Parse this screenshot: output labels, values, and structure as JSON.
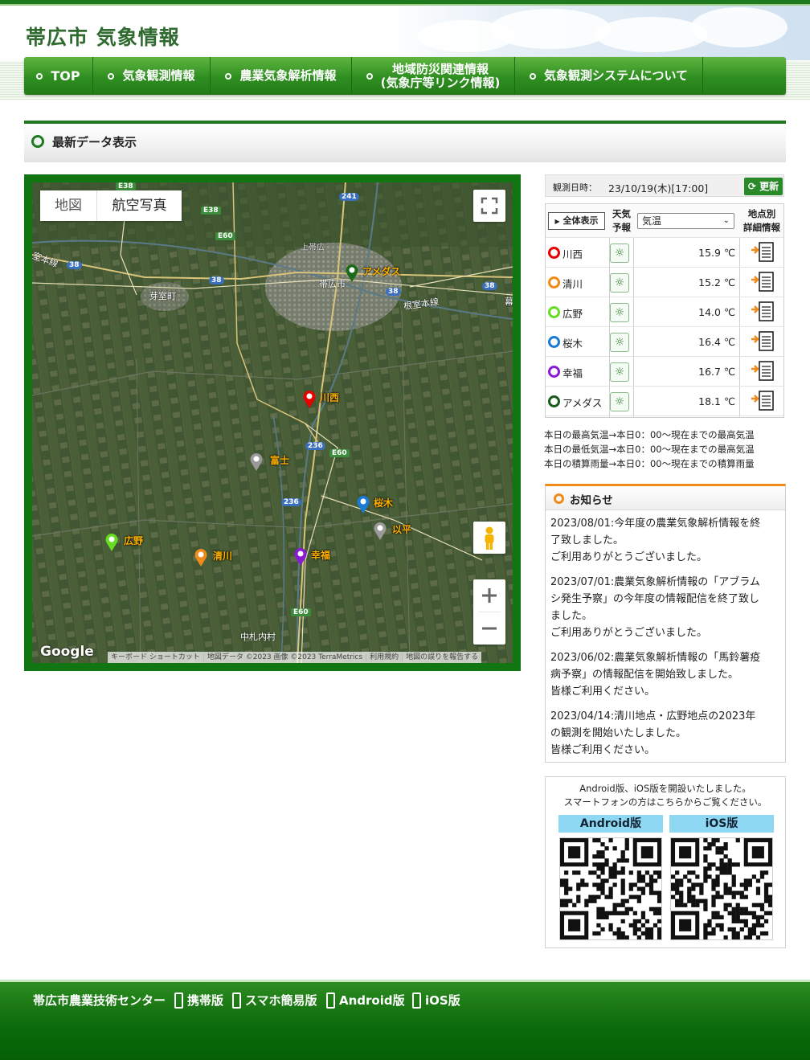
{
  "site": {
    "title": "帯広市 気象情報"
  },
  "nav": {
    "items": [
      {
        "label": "TOP"
      },
      {
        "label": "気象観測情報"
      },
      {
        "label": "農業気象解析情報"
      },
      {
        "label": "地域防災関連情報",
        "label2": "(気象庁等リンク情報)"
      },
      {
        "label": "気象観測システムについて"
      }
    ]
  },
  "section": {
    "title": "最新データ表示"
  },
  "map": {
    "type_buttons": [
      "地図",
      "航空写真"
    ],
    "attribution": [
      "キーボード ショートカット",
      "地図データ ©2023 画像 ©2023 TerraMetrics",
      "利用規約",
      "地図の誤りを報告する"
    ],
    "google": "Google",
    "place_labels": [
      "帯広市",
      "芽室町",
      "中札内村",
      "上帯広",
      "根室本線",
      "室本線",
      "幕"
    ],
    "road_labels": [
      "E38",
      "E38",
      "E60",
      "E60",
      "E60",
      "38",
      "38",
      "38",
      "38",
      "241",
      "236",
      "236"
    ],
    "markers": [
      {
        "name": "アメダス",
        "color": "#1a6a1a"
      },
      {
        "name": "川西",
        "color": "#e60000"
      },
      {
        "name": "富士",
        "color": "#999999"
      },
      {
        "name": "桜木",
        "color": "#1a7ad6"
      },
      {
        "name": "以平",
        "color": "#999999"
      },
      {
        "name": "広野",
        "color": "#66dd22"
      },
      {
        "name": "清川",
        "color": "#f08a19"
      },
      {
        "name": "幸福",
        "color": "#8a1ad6"
      }
    ]
  },
  "observation": {
    "label": "観測日時：",
    "datetime": "23/10/19(木)[17:00]",
    "update": "更新"
  },
  "table": {
    "show_all": "全体表示",
    "h_weather": [
      "天気",
      "予報"
    ],
    "h_detail": [
      "地点別",
      "詳細情報"
    ],
    "select_value": "気温",
    "rows": [
      {
        "name": "川西",
        "temp": "15.9 ℃",
        "color": "#e60000"
      },
      {
        "name": "清川",
        "temp": "15.2 ℃",
        "color": "#f08a19"
      },
      {
        "name": "広野",
        "temp": "14.0 ℃",
        "color": "#66dd22"
      },
      {
        "name": "桜木",
        "temp": "16.4 ℃",
        "color": "#1a7ad6"
      },
      {
        "name": "幸福",
        "temp": "16.7 ℃",
        "color": "#8a1ad6"
      },
      {
        "name": "アメダス",
        "temp": "18.1 ℃",
        "color": "#1a5a1a"
      }
    ]
  },
  "notes": [
    "本日の最高気温→本日0：00〜現在までの最高気温",
    "本日の最低気温→本日0：00〜現在までの最高気温",
    "本日の積算雨量→本日0：00〜現在までの積算雨量"
  ],
  "news": {
    "title": "お知らせ",
    "items": [
      {
        "lines": [
          "2023/08/01:今年度の農業気象解析情報を終",
          "了致しました。",
          "ご利用ありがとうございました。"
        ]
      },
      {
        "lines": [
          "2023/07/01:農業気象解析情報の「アブラム",
          "シ発生予察」の今年度の情報配信を終了致し",
          "ました。",
          "ご利用ありがとうございました。"
        ]
      },
      {
        "lines": [
          "2023/06/02:農業気象解析情報の「馬鈴薯疫",
          "病予察」の情報配信を開始致しました。",
          "皆様ご利用ください。"
        ]
      },
      {
        "lines": [
          "2023/04/14:清川地点・広野地点の2023年",
          "の観測を開始いたしました。",
          "皆様ご利用ください。"
        ]
      }
    ]
  },
  "app": {
    "line1": "Android版、iOS版を開設いたしました。",
    "line2": "スマートフォンの方はこちらからご覧ください。",
    "android": "Android版",
    "ios": "iOS版"
  },
  "footer": {
    "center": "帯広市農業技術センター",
    "links": [
      "携帯版",
      "スマホ簡易版",
      "Android版",
      "iOS版"
    ]
  },
  "colors": {
    "brand_green": "#1f7a1f",
    "accent_orange": "#f08a19",
    "app_label_bg": "#8fd8f3"
  }
}
